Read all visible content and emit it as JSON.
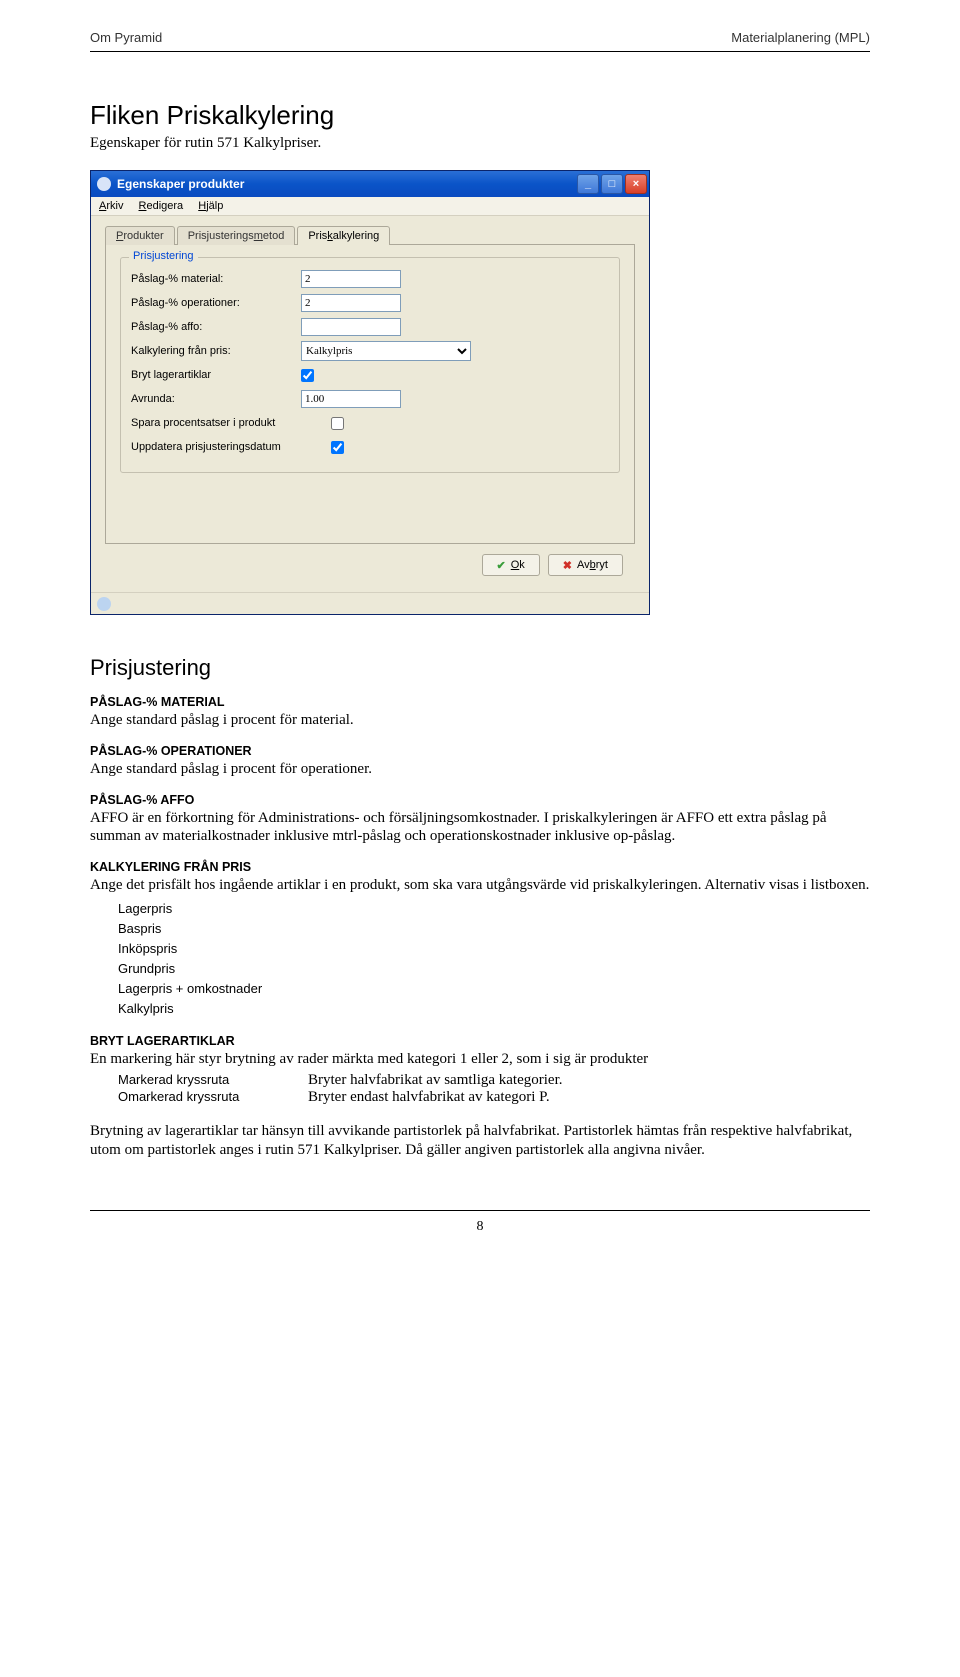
{
  "header": {
    "left": "Om Pyramid",
    "right": "Materialplanering (MPL)"
  },
  "section": {
    "title": "Fliken Priskalkylering",
    "subtitle": "Egenskaper för rutin 571 Kalkylpriser."
  },
  "dlg": {
    "title": "Egenskaper produkter",
    "menu": {
      "arkiv": "Arkiv",
      "redigera": "Redigera",
      "hjalp": "Hjälp",
      "arkiv_u": "A",
      "redigera_u": "R",
      "hjalp_u": "H"
    },
    "tabs": {
      "t0": "Produkter",
      "t0_u": "P",
      "t1": "Prisjusteringsmetod",
      "t1_u": "m",
      "t2": "Priskalkylering",
      "t2_u": "k"
    },
    "legend": "Prisjustering",
    "fields": {
      "l0": "Påslag-% material:",
      "v0": "2",
      "l1": "Påslag-% operationer:",
      "v1": "2",
      "l2": "Påslag-% affo:",
      "v2": "",
      "l3": "Kalkylering från pris:",
      "v3": "Kalkylpris",
      "l4": "Bryt lagerartiklar",
      "l5": "Avrunda:",
      "v5": "1.00",
      "l6": "Spara procentsatser i produkt",
      "l7": "Uppdatera prisjusteringsdatum"
    },
    "buttons": {
      "ok": "Ok",
      "ok_u": "O",
      "cancel": "Avbryt",
      "cancel_u": "b"
    }
  },
  "art": {
    "h2": "Prisjustering",
    "s0h": "PÅSLAG-% MATERIAL",
    "s0": "Ange standard påslag i procent för material.",
    "s1h": "PÅSLAG-% OPERATIONER",
    "s1": "Ange standard påslag i procent för operationer.",
    "s2h": "PÅSLAG-% AFFO",
    "s2": "AFFO är en förkortning för Administrations- och försäljningsomkostnader. I priskalkyleringen är AFFO ett extra påslag på summan av materialkostnader inklusive mtrl-påslag och operationskostnader inklusive op-påslag.",
    "s3h": "KALKYLERING FRÅN PRIS",
    "s3": "Ange det prisfält hos ingående artiklar i en produkt, som ska vara utgångsvärde vid priskalkyleringen. Alternativ visas i listboxen.",
    "list0": "Lagerpris",
    "list1": "Baspris",
    "list2": "Inköpspris",
    "list3": "Grundpris",
    "list4": "Lagerpris + omkostnader",
    "list5": "Kalkylpris",
    "s4h": "BRYT LAGERARTIKLAR",
    "s4": "En markering här styr brytning av rader märkta med kategori 1 eller 2, som i sig är produkter",
    "kv0k": "Markerad kryssruta",
    "kv0v": "Bryter halvfabrikat av samtliga kategorier.",
    "kv1k": "Omarkerad kryssruta",
    "kv1v": "Bryter endast halvfabrikat av kategori P.",
    "s5": "Brytning av lagerartiklar tar hänsyn till avvikande partistorlek på halvfabrikat. Partistorlek hämtas från respektive halvfabrikat, utom om partistorlek anges i rutin 571 Kalkylpriser. Då gäller angiven partistorlek alla angivna nivåer."
  },
  "footer": {
    "page": "8"
  }
}
